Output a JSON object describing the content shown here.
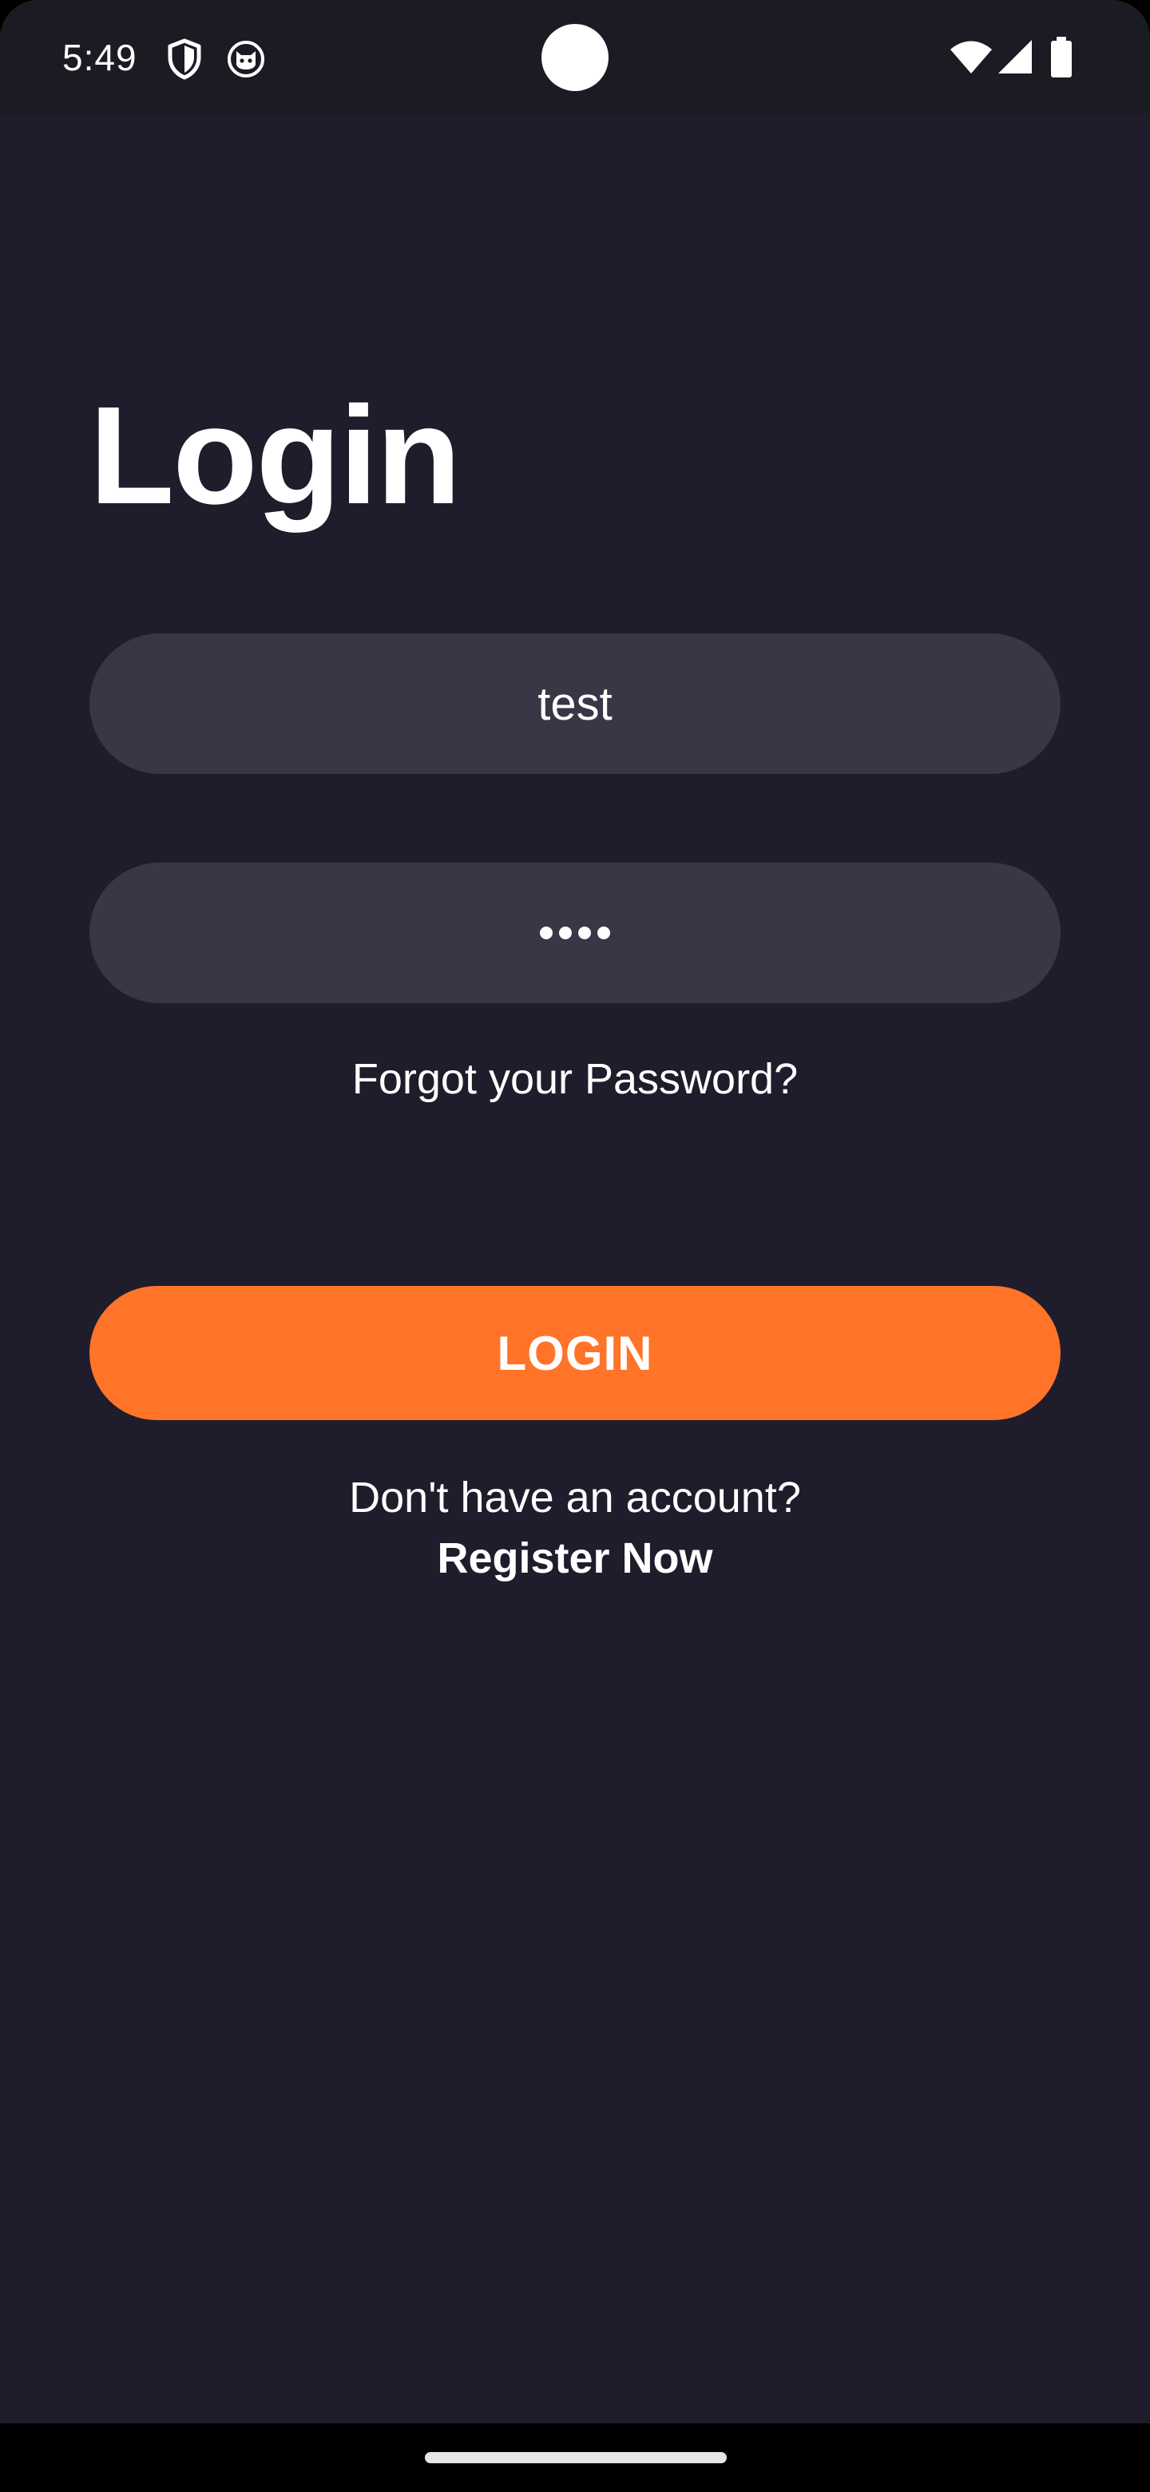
{
  "status_bar": {
    "time": "5:49",
    "icons": [
      "shield-icon",
      "cat-icon",
      "camera-cutout",
      "wifi-icon",
      "signal-icon",
      "battery-icon"
    ]
  },
  "login": {
    "title": "Login",
    "username_value": "test",
    "password_value": "1234",
    "forgot_password": "Forgot your Password?",
    "login_button": "LOGIN",
    "no_account": "Don't have an account?",
    "register_link": "Register Now"
  },
  "colors": {
    "background": "#1f1d2c",
    "status_bar": "#1a1b23",
    "field": "#393746",
    "accent": "#ff7428",
    "text": "#ffffff"
  }
}
